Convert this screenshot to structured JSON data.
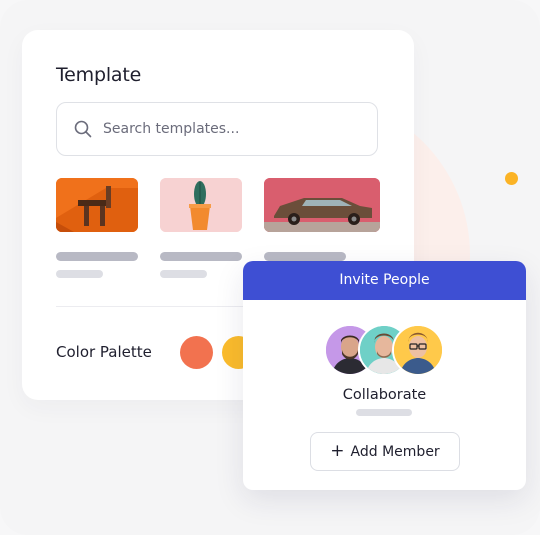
{
  "template_card": {
    "title": "Template",
    "search": {
      "placeholder": "Search templates..."
    },
    "thumbnails": [
      {
        "name": "orange-wooden-chair-thumbnail"
      },
      {
        "name": "cactus-pot-thumbnail"
      },
      {
        "name": "vintage-car-thumbnail"
      }
    ],
    "color_palette": {
      "label": "Color Palette",
      "colors": [
        "#f2724f",
        "#fbbc2c"
      ]
    }
  },
  "invite_card": {
    "title": "Invite People",
    "avatars": [
      {
        "icon": "avatar-icon",
        "color": "#c598e8"
      },
      {
        "icon": "avatar-icon",
        "color": "#6fd0c7"
      },
      {
        "icon": "avatar-icon",
        "color": "#ffc94a"
      }
    ],
    "collaborate_label": "Collaborate",
    "add_member": {
      "icon": "plus-icon",
      "label": "Add Member"
    }
  },
  "colors": {
    "accent": "#3e4fd3",
    "dot": "#fbb325"
  }
}
